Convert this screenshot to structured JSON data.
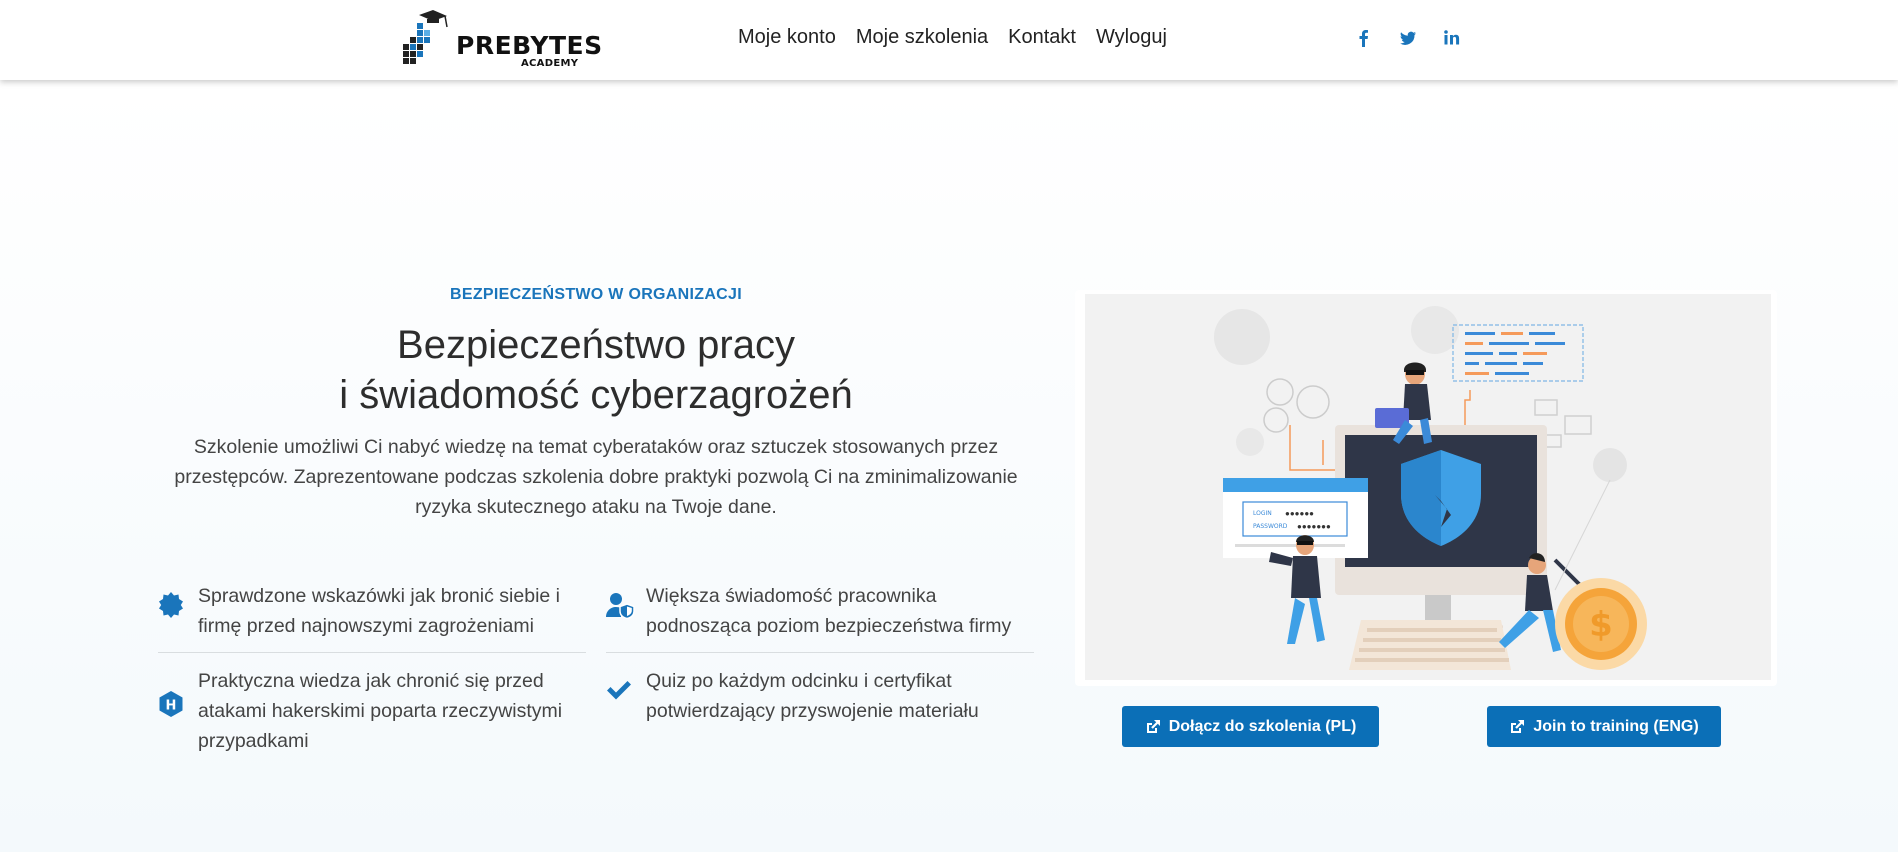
{
  "header": {
    "logo_text": "PREBYTES",
    "logo_sub": "ACADEMY",
    "nav": [
      "Moje konto",
      "Moje szkolenia",
      "Kontakt",
      "Wyloguj"
    ],
    "social": [
      "facebook-icon",
      "twitter-icon",
      "linkedin-icon"
    ]
  },
  "hero": {
    "eyebrow": "BEZPIECZEŃSTWO W ORGANIZACJI",
    "title_line1": "Bezpieczeństwo pracy",
    "title_line2": "i świadomość cyberzagrożeń",
    "lead": "Szkolenie umożliwi Ci nabyć wiedzę na temat cyberataków oraz sztuczek stosowanych przez przestępców.  Zaprezentowane podczas szkolenia dobre praktyki pozwolą Ci na zminimalizowanie ryzyka skutecznego ataku na Twoje dane."
  },
  "features": [
    {
      "icon": "badge-icon",
      "text": "Sprawdzone wskazówki jak bronić siebie i firmę przed najnowszymi zagrożeniami"
    },
    {
      "icon": "user-shield-icon",
      "text": "Większa świadomość pracownika podnosząca poziom bezpieczeństwa firmy"
    },
    {
      "icon": "hacker-hex-icon",
      "text": "Praktyczna wiedza jak chronić się przed atakami hakerskimi poparta rzeczywistymi przypadkami"
    },
    {
      "icon": "checkmark-icon",
      "text": "Quiz po każdym odcinku i certyfikat potwierdzający przyswojenie materiału"
    }
  ],
  "illustration": {
    "login_label": "LOGIN",
    "password_label": "PASSWORD"
  },
  "buttons": {
    "join_pl": "Dołącz do szkolenia (PL)",
    "join_eng": "Join to training (ENG)"
  },
  "colors": {
    "accent": "#1a75bb",
    "button": "#0b6fb7"
  }
}
